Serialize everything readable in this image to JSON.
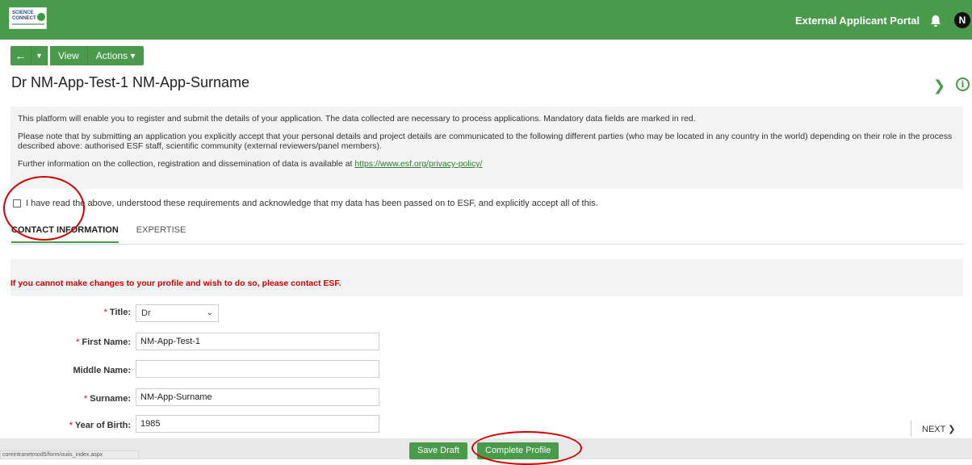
{
  "header": {
    "logo_text_1": "SCIENCE",
    "logo_text_2": "CONNECT",
    "portal_title": "External Applicant Portal",
    "avatar_initial": "N"
  },
  "toolbar": {
    "back_label": "←",
    "caret_label": "▼",
    "view_label": "View",
    "actions_label": "Actions ▾"
  },
  "page": {
    "title": "Dr NM-App-Test-1 NM-App-Surname"
  },
  "info": {
    "para1": "This platform will enable you to register and submit the details of your application. The data collected are necessary to process applications. Mandatory data fields are marked in red.",
    "para2": "Please note that by submitting an application you explicitly accept that your personal details and project details are communicated to the following different parties (who may be located in any country in the world) depending on their role in the process described above: authorised ESF staff, scientific community (external reviewers/panel members).",
    "para3_prefix": "Further information on the collection, registration and dissemination of data is available at ",
    "privacy_link": "https://www.esf.org/privacy-policy/"
  },
  "consent": {
    "label": "I have read the above, understood these requirements and acknowledge that my data has been passed on to ESF, and explicitly accept all of this."
  },
  "tabs": {
    "contact": "CONTACT INFORMATION",
    "expertise": "EXPERTISE"
  },
  "warning": "If you cannot make changes to your profile and wish to do so, please contact ESF.",
  "form": {
    "title_label": "Title:",
    "title_value": "Dr",
    "first_name_label": "First Name:",
    "first_name_value": "NM-App-Test-1",
    "middle_name_label": "Middle Name:",
    "middle_name_value": "",
    "surname_label": "Surname:",
    "surname_value": "NM-App-Surname",
    "year_label": "Year of Birth:",
    "year_value": "1985",
    "required_mark": "*"
  },
  "nav": {
    "next_label": "NEXT ❯"
  },
  "actions": {
    "save_draft": "Save Draft",
    "complete_profile": "Complete Profile"
  },
  "status_bar": {
    "url": "coreintranetmod5/form/ouiis_index.aspx"
  },
  "colors": {
    "brand_green": "#4a9a4c",
    "required_red": "#d50000",
    "annotation_red": "#d40000"
  },
  "icons": {
    "bell": "bell-icon",
    "info": "info-icon",
    "expand": "chevron-right-icon"
  }
}
